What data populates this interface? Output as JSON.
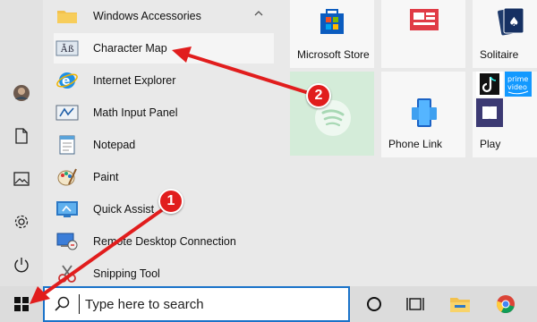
{
  "folder": {
    "label": "Windows Accessories",
    "icon": "folder-icon"
  },
  "apps": [
    {
      "label": "Character Map",
      "icon": "character-map-icon",
      "selected": true
    },
    {
      "label": "Internet Explorer",
      "icon": "internet-explorer-icon"
    },
    {
      "label": "Math Input Panel",
      "icon": "math-input-panel-icon"
    },
    {
      "label": "Notepad",
      "icon": "notepad-icon"
    },
    {
      "label": "Paint",
      "icon": "paint-icon"
    },
    {
      "label": "Quick Assist",
      "icon": "quick-assist-icon"
    },
    {
      "label": "Remote Desktop Connection",
      "icon": "remote-desktop-icon"
    },
    {
      "label": "Snipping Tool",
      "icon": "snipping-tool-icon"
    }
  ],
  "tiles": {
    "microsoft_store": "Microsoft Store",
    "news": "",
    "solitaire": "Solitaire",
    "phone_link": "Phone Link",
    "play": "Play"
  },
  "search": {
    "placeholder": "Type here to search"
  },
  "annotations": {
    "step1": "1",
    "step2": "2"
  },
  "colors": {
    "accent": "#1a73c9",
    "annotation": "#e11d1d",
    "spotify_tile": "#d4ecd9"
  }
}
